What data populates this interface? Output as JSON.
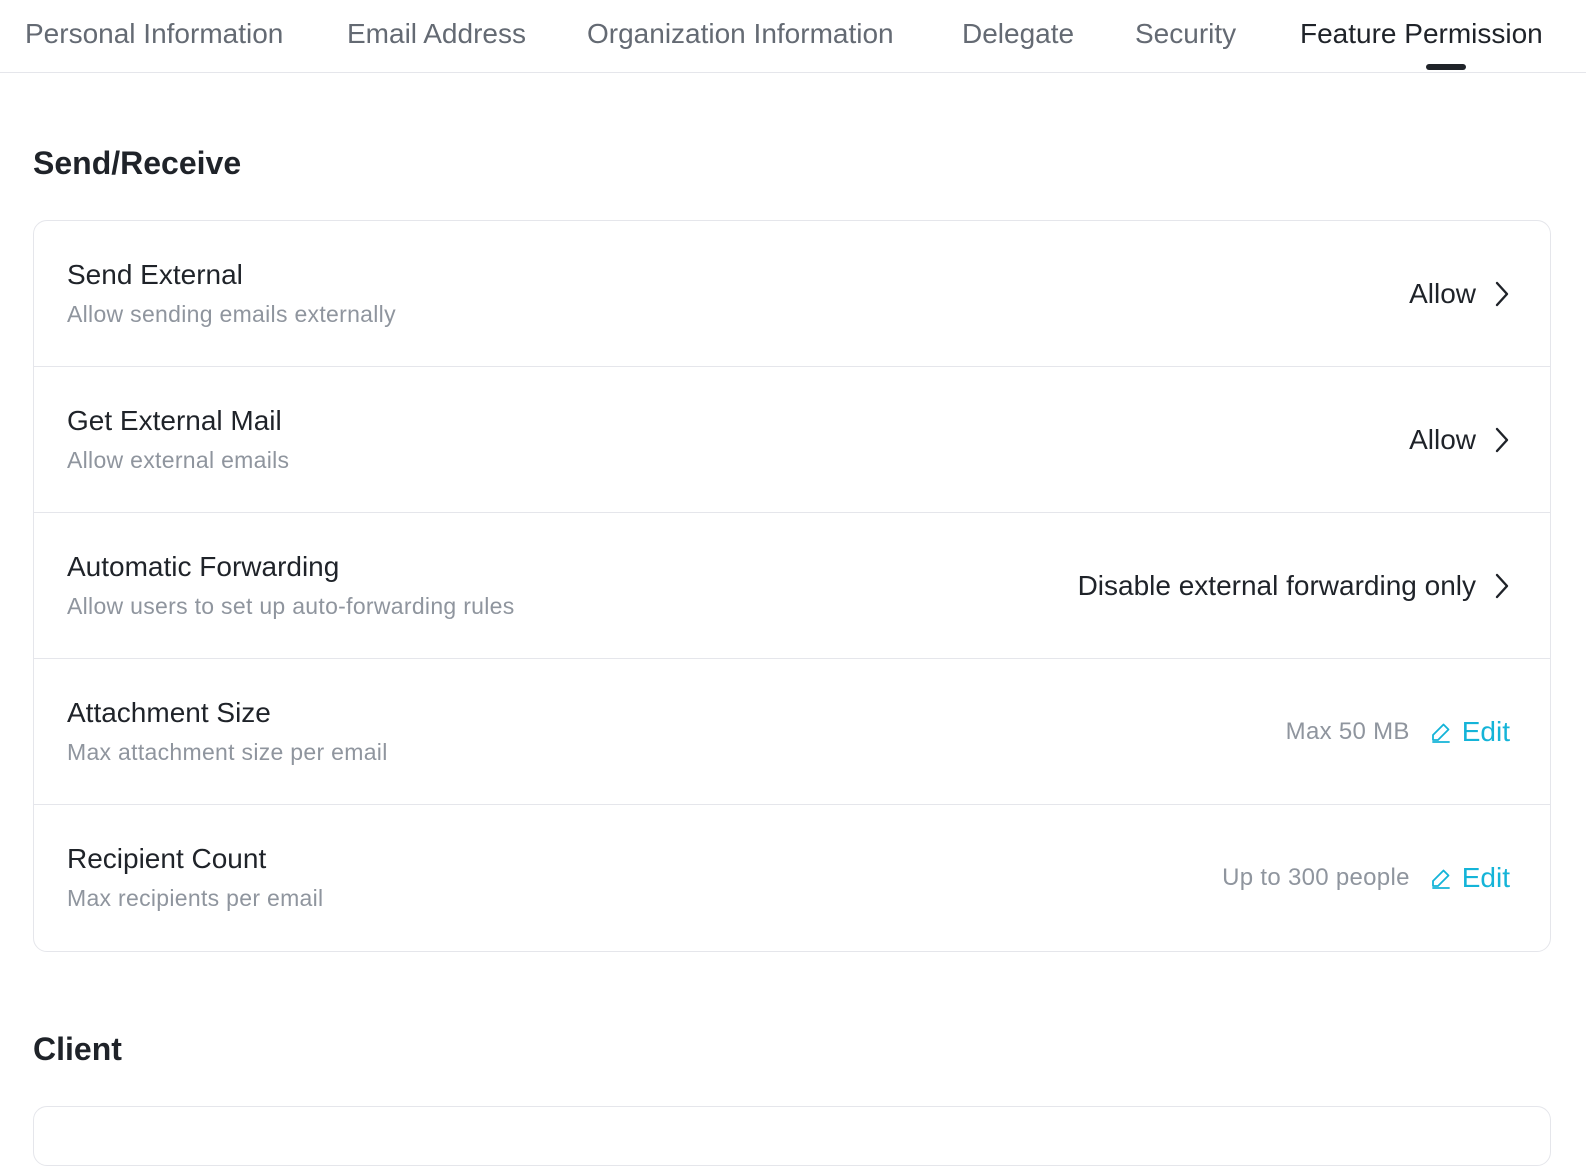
{
  "tabs": [
    {
      "label": "Personal Information"
    },
    {
      "label": "Email Address"
    },
    {
      "label": "Organization Information"
    },
    {
      "label": "Delegate"
    },
    {
      "label": "Security"
    },
    {
      "label": "Feature Permission",
      "active": true
    }
  ],
  "sections": {
    "send_receive": {
      "title": "Send/Receive",
      "rows": [
        {
          "title": "Send External",
          "description": "Allow sending emails externally",
          "value": "Allow"
        },
        {
          "title": "Get External Mail",
          "description": "Allow external emails",
          "value": "Allow"
        },
        {
          "title": "Automatic Forwarding",
          "description": "Allow users to set up auto-forwarding rules",
          "value": "Disable external forwarding only"
        },
        {
          "title": "Attachment Size",
          "description": "Max attachment size per email",
          "value": "Max 50 MB",
          "action": "Edit"
        },
        {
          "title": "Recipient Count",
          "description": "Max recipients per email",
          "value": "Up to 300 people",
          "action": "Edit"
        }
      ]
    },
    "client": {
      "title": "Client"
    }
  },
  "icons": {
    "chevron": "chevron-right-icon",
    "edit": "pencil-icon"
  },
  "colors": {
    "accent": "#14b4d8",
    "text_primary": "#1f2329",
    "text_secondary": "#8f959e",
    "border": "#e5e6eb"
  }
}
